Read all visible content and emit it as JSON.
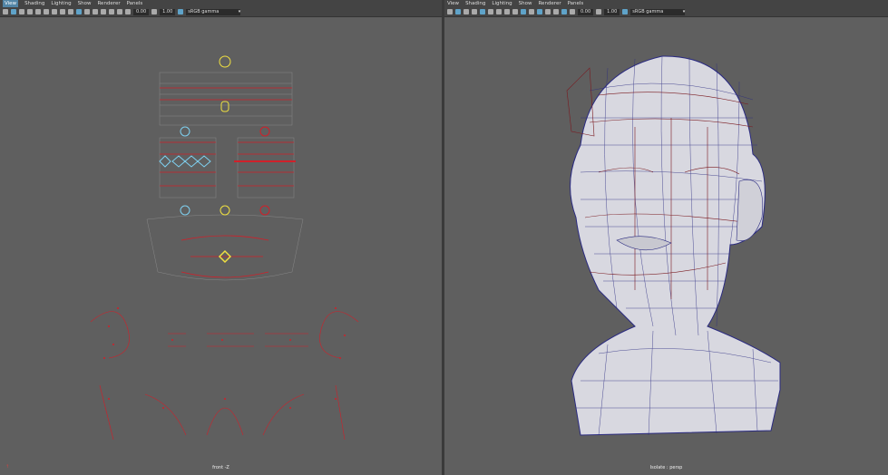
{
  "menu": [
    "View",
    "Shading",
    "Lighting",
    "Show",
    "Renderer",
    "Panels"
  ],
  "toolbar": {
    "exposure": "0.00",
    "gamma": "1.00",
    "color_space": "sRGB gamma",
    "dropdown_icon": "chevron-down-icon"
  },
  "left_panel": {
    "camera_label": "front -Z"
  },
  "right_panel": {
    "camera_label": "Isolate : persp"
  },
  "colors": {
    "background": "#5f5f5f",
    "control_red": "#d0202a",
    "control_blue": "#7fd0f0",
    "control_yellow": "#f0e040",
    "mesh_blue": "#2a2a80"
  }
}
